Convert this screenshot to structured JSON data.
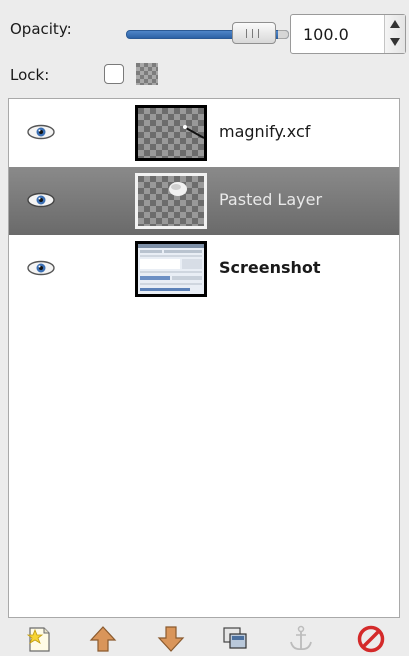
{
  "opacity": {
    "label": "Opacity:",
    "value": "100.0",
    "slider_fraction": 1.0
  },
  "lock": {
    "label": "Lock:",
    "pixels_locked": false,
    "icons": [
      "checkbox",
      "alpha-checker-icon"
    ]
  },
  "layers": [
    {
      "name": "magnify.xcf",
      "visible": true,
      "selected": false,
      "bold": false,
      "thumbnail": "transparent-with-line"
    },
    {
      "name": "Pasted Layer",
      "visible": true,
      "selected": true,
      "bold": false,
      "thumbnail": "transparent-with-blob"
    },
    {
      "name": "Screenshot",
      "visible": true,
      "selected": false,
      "bold": true,
      "thumbnail": "screenshot"
    }
  ],
  "toolbar": {
    "buttons": [
      {
        "name": "new-layer-icon"
      },
      {
        "name": "raise-layer-icon"
      },
      {
        "name": "lower-layer-icon"
      },
      {
        "name": "duplicate-layer-icon"
      },
      {
        "name": "anchor-layer-icon",
        "disabled": true
      },
      {
        "name": "delete-layer-icon"
      }
    ]
  },
  "colors": {
    "slider_fill": "#2d62a6",
    "selected_row": "#7a7a7a",
    "delete": "#d42a2a",
    "arrows": "#c47c35"
  }
}
